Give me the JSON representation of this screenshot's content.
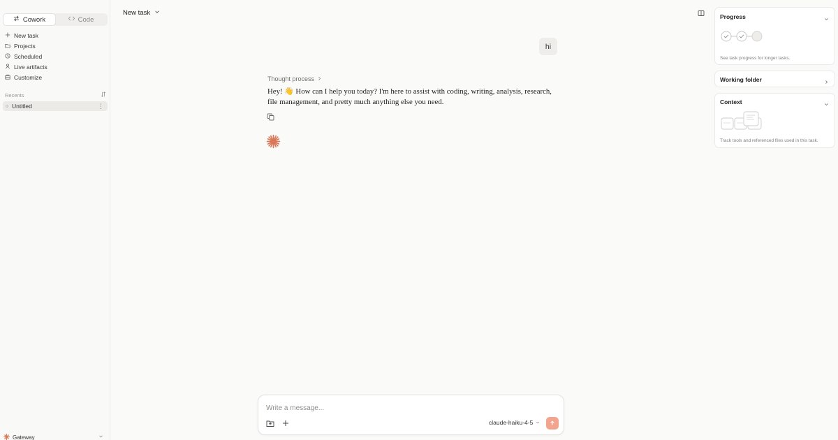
{
  "sidebar": {
    "modes": [
      {
        "label": "Cowork",
        "icon": "cowork-icon",
        "active": true
      },
      {
        "label": "Code",
        "icon": "code-icon",
        "active": false
      }
    ],
    "nav": [
      {
        "label": "New task",
        "icon": "plus-icon"
      },
      {
        "label": "Projects",
        "icon": "folder-icon"
      },
      {
        "label": "Scheduled",
        "icon": "clock-icon"
      },
      {
        "label": "Live artifacts",
        "icon": "artifacts-icon"
      },
      {
        "label": "Customize",
        "icon": "briefcase-icon"
      }
    ],
    "recents_label": "Recents",
    "recents": [
      {
        "label": "Untitled"
      }
    ],
    "gateway_label": "Gateway"
  },
  "header": {
    "title": "New task"
  },
  "chat": {
    "user_message": "hi",
    "thought_label": "Thought process",
    "assistant_message": "Hey! 👋 How can I help you today? I'm here to assist with coding, writing, analysis, research, file management, and pretty much anything else you need."
  },
  "composer": {
    "placeholder": "Write a message...",
    "model": "claude-haiku-4-5"
  },
  "panel": {
    "progress": {
      "title": "Progress",
      "description": "See task progress for longer tasks."
    },
    "working_folder": {
      "title": "Working folder"
    },
    "context": {
      "title": "Context",
      "description": "Track tools and referenced files used in this task."
    }
  },
  "colors": {
    "accent": "#d97757",
    "send_button": "#f2a48f",
    "background": "#fafaf8"
  }
}
